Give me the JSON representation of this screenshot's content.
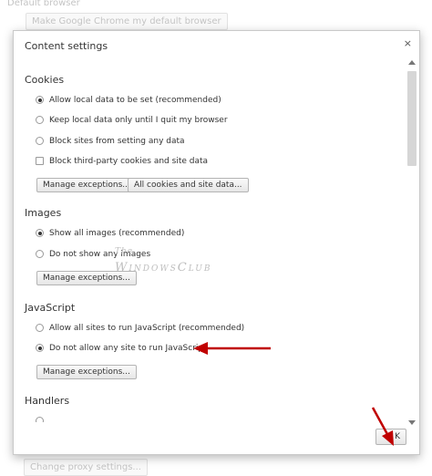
{
  "background": {
    "default_browser_heading": "Default browser",
    "make_default_button": "Make Google Chrome my default browser",
    "change_proxy_button": "Change proxy settings..."
  },
  "dialog": {
    "title": "Content settings",
    "close_label": "×",
    "ok_label": "K"
  },
  "sections": {
    "cookies": {
      "title": "Cookies",
      "options": [
        {
          "label": "Allow local data to be set (recommended)",
          "selected": true
        },
        {
          "label": "Keep local data only until I quit my browser",
          "selected": false
        },
        {
          "label": "Block sites from setting any data",
          "selected": false
        }
      ],
      "checkbox": {
        "label": "Block third-party cookies and site data",
        "checked": false
      },
      "manage_button": "Manage exceptions...",
      "all_cookies_button": "All cookies and site data..."
    },
    "images": {
      "title": "Images",
      "options": [
        {
          "label": "Show all images (recommended)",
          "selected": true
        },
        {
          "label": "Do not show any images",
          "selected": false
        }
      ],
      "manage_button": "Manage exceptions..."
    },
    "javascript": {
      "title": "JavaScript",
      "options": [
        {
          "label": "Allow all sites to run JavaScript (recommended)",
          "selected": false
        },
        {
          "label": "Do not allow any site to run JavaScript",
          "selected": true
        }
      ],
      "manage_button": "Manage exceptions..."
    },
    "handlers": {
      "title": "Handlers"
    }
  },
  "watermark": {
    "line1": "The",
    "line2": "WindowsClub"
  },
  "colors": {
    "annotation_arrow": "#c00000",
    "dialog_border": "#c9c9c9"
  }
}
